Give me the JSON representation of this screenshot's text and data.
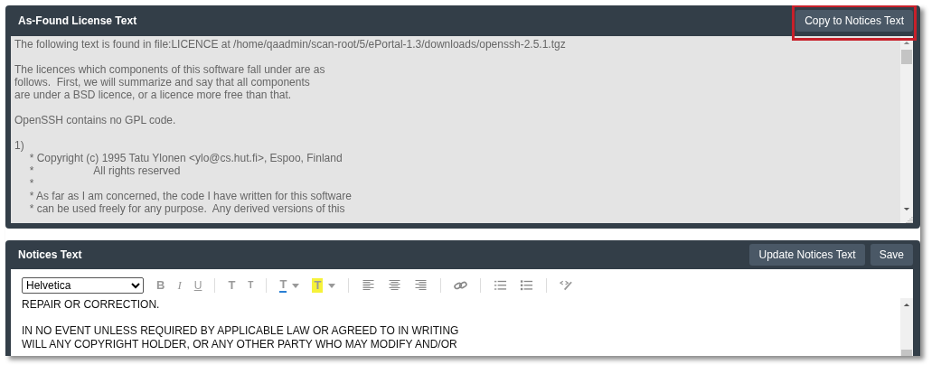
{
  "found_panel": {
    "title": "As-Found License Text",
    "copy_button": {
      "label": "Copy to Notices Text",
      "highlighted": true
    },
    "paragraphs": [
      [
        "The following text is found in file:LICENCE at /home/qaadmin/scan-root/5/ePortal-1.3/downloads/openssh-2.5.1.tgz"
      ],
      [
        "The licences which components of this software fall under are as",
        "follows.  First, we will summarize and say that all components",
        "are under a BSD licence, or a licence more free than that."
      ],
      [
        "OpenSSH contains no GPL code."
      ],
      [
        "1)",
        "     * Copyright (c) 1995 Tatu Ylonen <ylo@cs.hut.fi>, Espoo, Finland",
        "     *                    All rights reserved",
        "     *",
        "     * As far as I am concerned, the code I have written for this software",
        "     * can be used freely for any purpose.  Any derived versions of this"
      ]
    ]
  },
  "notices_panel": {
    "title": "Notices Text",
    "buttons": [
      "Update Notices Text",
      "Save"
    ],
    "font": "Helvetica",
    "toolbar": [
      [
        {
          "kind": "bold",
          "label": "B"
        },
        {
          "kind": "italic",
          "label": "I"
        },
        {
          "kind": "underline",
          "label": "U"
        }
      ],
      [
        {
          "kind": "grow",
          "label": "T"
        },
        {
          "kind": "shrink",
          "label": "T"
        }
      ],
      [
        {
          "kind": "color",
          "label": "T"
        },
        {
          "kind": "highlight",
          "label": "T"
        }
      ],
      [
        {
          "kind": "align-left"
        },
        {
          "kind": "align-center"
        },
        {
          "kind": "align-right"
        }
      ],
      [
        {
          "kind": "link"
        }
      ],
      [
        {
          "kind": "ordered-list"
        },
        {
          "kind": "bullet-list"
        }
      ],
      [
        {
          "kind": "code"
        }
      ]
    ],
    "paragraphs": [
      [
        "REPAIR OR CORRECTION."
      ],
      [
        "IN NO EVENT UNLESS REQUIRED BY APPLICABLE LAW OR AGREED TO IN WRITING",
        "WILL ANY COPYRIGHT HOLDER, OR ANY OTHER PARTY WHO MAY MODIFY AND/OR"
      ]
    ]
  }
}
